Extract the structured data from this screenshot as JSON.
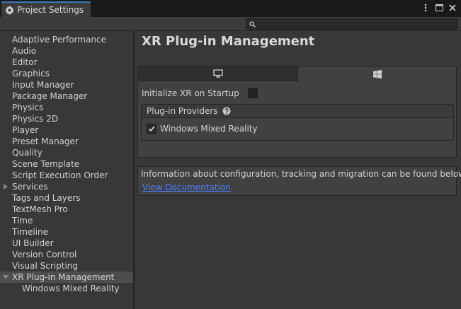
{
  "window": {
    "tab_title": "Project Settings",
    "controls": [
      "more-vertical-icon",
      "maximize-icon",
      "close-icon"
    ]
  },
  "toolbar": {
    "search_placeholder": ""
  },
  "sidebar": {
    "items": [
      {
        "label": "Adaptive Performance"
      },
      {
        "label": "Audio"
      },
      {
        "label": "Editor"
      },
      {
        "label": "Graphics"
      },
      {
        "label": "Input Manager"
      },
      {
        "label": "Package Manager"
      },
      {
        "label": "Physics"
      },
      {
        "label": "Physics 2D"
      },
      {
        "label": "Player"
      },
      {
        "label": "Preset Manager"
      },
      {
        "label": "Quality"
      },
      {
        "label": "Scene Template"
      },
      {
        "label": "Script Execution Order"
      },
      {
        "label": "Services",
        "expandable": true,
        "expanded": false
      },
      {
        "label": "Tags and Layers"
      },
      {
        "label": "TextMesh Pro"
      },
      {
        "label": "Time"
      },
      {
        "label": "Timeline"
      },
      {
        "label": "UI Builder"
      },
      {
        "label": "Version Control"
      },
      {
        "label": "Visual Scripting"
      },
      {
        "label": "XR Plug-in Management",
        "expandable": true,
        "expanded": true,
        "selected": true
      },
      {
        "label": "Windows Mixed Reality",
        "child": true
      }
    ]
  },
  "main": {
    "title": "XR Plug-in Management",
    "platform_tabs": [
      {
        "icon": "monitor-icon",
        "selected": false
      },
      {
        "icon": "windows-logo-icon",
        "selected": true
      }
    ],
    "init_xr_label": "Initialize XR on Startup",
    "init_xr_checked": false,
    "providers": {
      "header": "Plug-in Providers",
      "items": [
        {
          "label": "Windows Mixed Reality",
          "checked": true
        }
      ]
    },
    "info_text": "Information about configuration, tracking and migration can be found below.",
    "doc_link": "View Documentation"
  },
  "colors": {
    "accent_tab": "#3a79bb",
    "link": "#4c7fff",
    "selected_item": "#4d4d4d"
  }
}
